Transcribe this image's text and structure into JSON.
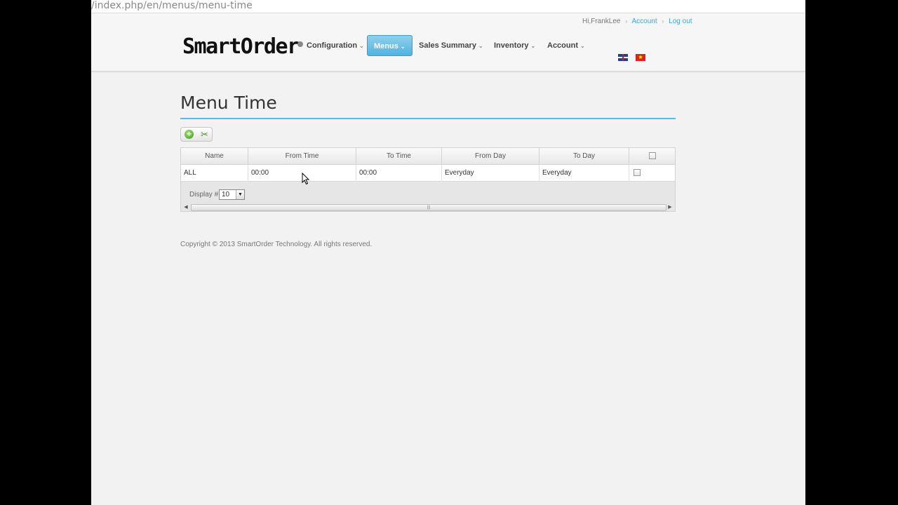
{
  "browser": {
    "url": "/index.php/en/menus/menu-time"
  },
  "header": {
    "greeting": "Hi,FrankLee",
    "account_link": "Account",
    "logout_link": "Log out",
    "logo_text": "SmartOrder",
    "nav": [
      {
        "label": "Configuration",
        "active": false
      },
      {
        "label": "Menus",
        "active": true
      },
      {
        "label": "Sales Summary",
        "active": false
      },
      {
        "label": "Inventory",
        "active": false
      },
      {
        "label": "Account",
        "active": false
      }
    ],
    "languages": [
      "English",
      "Vietnamese"
    ]
  },
  "page": {
    "title": "Menu Time"
  },
  "toolbar": {
    "add_icon": "add-icon",
    "cut_icon": "scissors-icon"
  },
  "grid": {
    "columns": [
      "Name",
      "From Time",
      "To Time",
      "From Day",
      "To Day"
    ],
    "rows": [
      {
        "name": "ALL",
        "from_time": "00:00",
        "to_time": "00:00",
        "from_day": "Everyday",
        "to_day": "Everyday"
      }
    ],
    "display_label": "Display #",
    "display_value": "10"
  },
  "footer": {
    "copyright": "Copyright © 2013 SmartOrder Technology. All rights reserved."
  },
  "colors": {
    "accent": "#5ab9e3",
    "link": "#3aa5d8",
    "active_nav": "#4fb4e2"
  }
}
